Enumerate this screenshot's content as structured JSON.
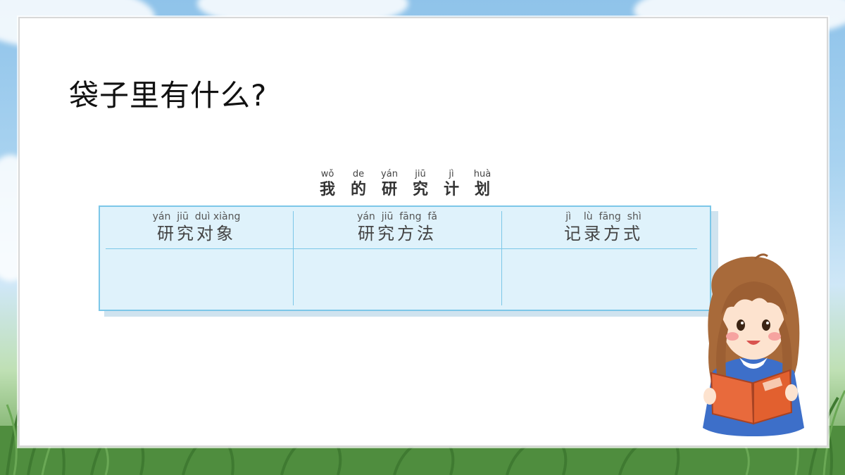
{
  "slide": {
    "title": "袋子里有什么?"
  },
  "plan": {
    "heading": [
      {
        "pinyin": "wǒ",
        "char": "我"
      },
      {
        "pinyin": "de",
        "char": "的"
      },
      {
        "pinyin": "yán",
        "char": "研"
      },
      {
        "pinyin": "jiū",
        "char": "究"
      },
      {
        "pinyin": "jì",
        "char": "计"
      },
      {
        "pinyin": "huà",
        "char": "划"
      }
    ],
    "columns": [
      {
        "pinyin": "yán  jiū  duì xiàng",
        "label": "研究对象"
      },
      {
        "pinyin": "yán  jiū  fāng  fǎ",
        "label": "研究方法"
      },
      {
        "pinyin": "jì    lù  fāng  shì",
        "label": "记录方式"
      }
    ]
  },
  "illustration": {
    "name": "girl-reading-book"
  }
}
